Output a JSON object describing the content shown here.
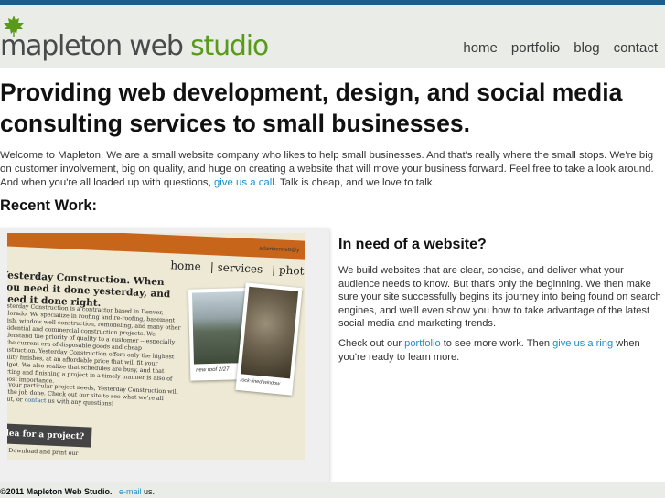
{
  "colors": {
    "topbar": "#1c5d8c",
    "header_bg": "#e9ece7",
    "logo_green": "#5a9a1a",
    "link": "#1a90c8"
  },
  "logo": {
    "part1": "mapleton web",
    "part2": "studio",
    "icon": "maple-leaf-icon"
  },
  "nav": [
    {
      "label": "home"
    },
    {
      "label": "portfolio"
    },
    {
      "label": "blog"
    },
    {
      "label": "contact"
    }
  ],
  "headline": "Providing web development, design, and social media consulting services to small businesses.",
  "intro": {
    "text1": "Welcome to Mapleton. We are a small website company who likes to help small businesses. And that's really where the small stops. We're big on customer involvement, big on quality, and huge on creating a website that will move your business forward. Feel free to take a look around. And when you're all loaded up with questions, ",
    "link": "give us a call",
    "text2": ". Talk is cheap, and we love to talk."
  },
  "recent_work": {
    "heading": "Recent Work:",
    "screenshot": {
      "email": "adambennett@y",
      "nav": [
        "home",
        "services",
        "photo"
      ],
      "title": "Yesterday Construction. When you need it done yesterday, and need it done right.",
      "body": "Yesterday Construction is a contractor based in Denver, Colorado. We specialize in roofing and re-roofing, basement finish, window well construction, remodeling, and many other residential and commercial construction projects. We understand the priority of quality to a customer -- especially in the current era of disposable goods and cheap construction. Yesterday Construction offers only the highest quality finishes, at an affordable price that will fit your budget. We also realize that schedules are busy, and that starting and finishing a project in a timely manner is also of utmost importance.",
      "body2_pre": "For your particular project needs, Yesterday Construction will get the job done. Check out our site to see what we're all about, or ",
      "body2_link": "contact",
      "body2_post": " us with any questions!",
      "idea": "idea for a project?",
      "download": "Download and print our",
      "photo1_caption": "new roof  2/27",
      "photo2_caption": "rock-lined window"
    }
  },
  "need": {
    "heading": "In need of a website?",
    "p1": "We build websites that are clear, concise, and deliver what your audience needs to know. But that's only the beginning. We then make sure your site successfully begins its journey into being found on search engines, and we'll even show you how to take advantage of the latest social media and marketing trends.",
    "p2_pre": "Check out our ",
    "p2_link1": "portfolio",
    "p2_mid": " to see more work. Then ",
    "p2_link2": "give us a ring",
    "p2_post": " when you're ready to learn more."
  },
  "footer": {
    "copyright": "©2011 Mapleton Web Studio.",
    "link": "e-mail",
    "post": " us."
  }
}
